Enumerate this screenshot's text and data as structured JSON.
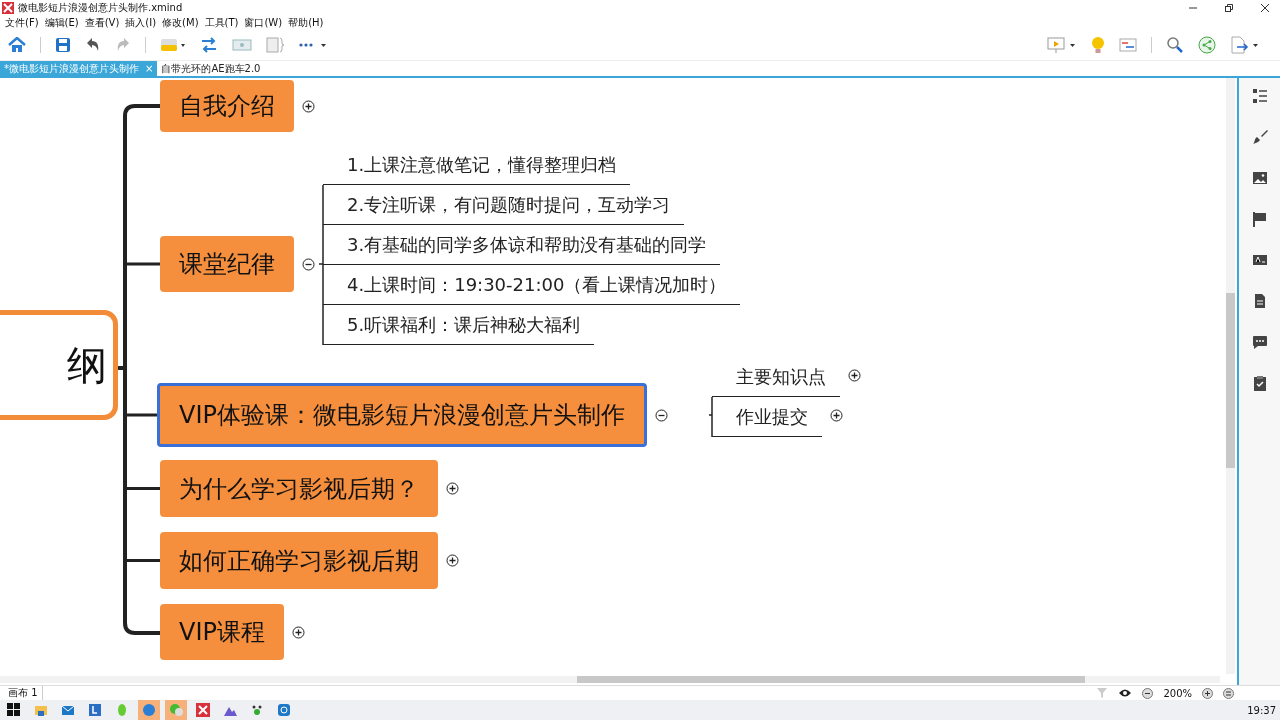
{
  "window": {
    "title": "微电影短片浪漫创意片头制作.xmind"
  },
  "menu": [
    "文件(F)",
    "编辑(E)",
    "查看(V)",
    "插入(I)",
    "修改(M)",
    "工具(T)",
    "窗口(W)",
    "帮助(H)"
  ],
  "tabs": [
    {
      "label": "*微电影短片浪漫创意片头制作",
      "selected": true,
      "close": "×"
    },
    {
      "label": "自带光环的AE跑车2.0",
      "selected": false
    }
  ],
  "mindmap": {
    "central": "纲",
    "topics": [
      {
        "text": "自我介绍",
        "selected": false,
        "expanded": false
      },
      {
        "text": "课堂纪律",
        "selected": false,
        "expanded": true,
        "children": [
          {
            "text": "1.上课注意做笔记，懂得整理归档"
          },
          {
            "text": "2.专注听课，有问题随时提问，互动学习"
          },
          {
            "text": "3.有基础的同学多体谅和帮助没有基础的同学"
          },
          {
            "text": "4.上课时间：19:30-21:00（看上课情况加时）"
          },
          {
            "text": "5.听课福利：课后神秘大福利"
          }
        ]
      },
      {
        "text": "VIP体验课：微电影短片浪漫创意片头制作",
        "selected": true,
        "expanded": true,
        "children": [
          {
            "text": "主要知识点",
            "expanded": false
          },
          {
            "text": "作业提交",
            "expanded": false
          }
        ]
      },
      {
        "text": "为什么学习影视后期？",
        "selected": false,
        "expanded": false
      },
      {
        "text": "如何正确学习影视后期",
        "selected": false,
        "expanded": false
      },
      {
        "text": "VIP课程",
        "selected": false,
        "expanded": false
      }
    ]
  },
  "status_bar": {
    "sheet_tab": "画布 1",
    "zoom": "200%"
  },
  "taskbar": {
    "time": "19:37"
  }
}
